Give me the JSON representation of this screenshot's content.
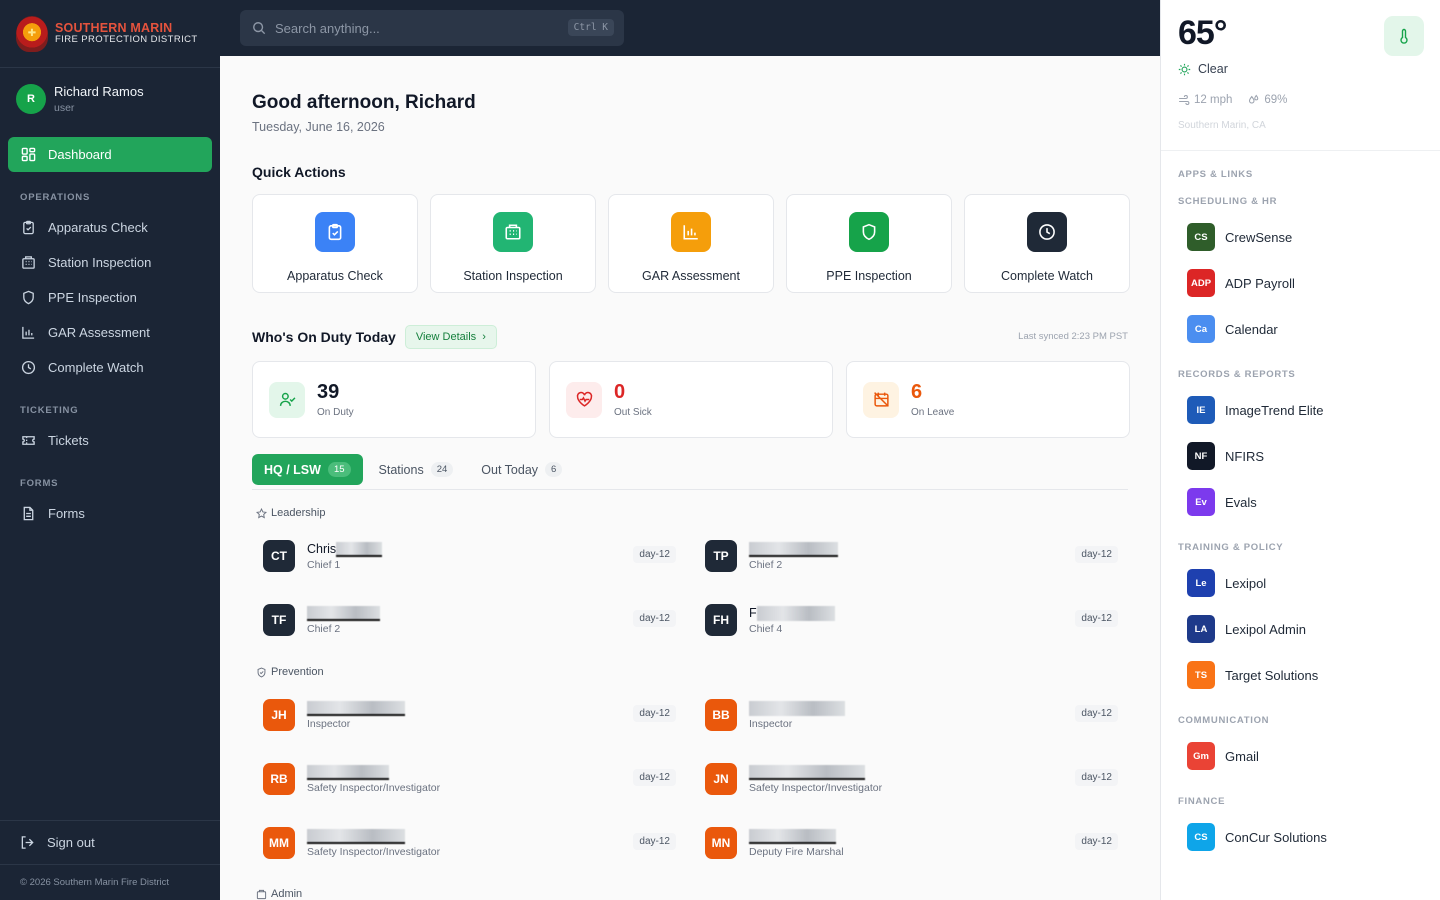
{
  "brand": {
    "line1": "SOUTHERN MARIN",
    "line2": "FIRE PROTECTION DISTRICT"
  },
  "user": {
    "initial": "R",
    "name": "Richard Ramos",
    "role": "user"
  },
  "sidebar": {
    "dashboard": "Dashboard",
    "sections": {
      "operations": "OPERATIONS",
      "ticketing": "TICKETING",
      "forms": "FORMS"
    },
    "items": {
      "apparatus_check": "Apparatus Check",
      "station_inspection": "Station Inspection",
      "ppe_inspection": "PPE Inspection",
      "gar_assessment": "GAR Assessment",
      "complete_watch": "Complete Watch",
      "tickets": "Tickets",
      "forms": "Forms"
    },
    "sign_out": "Sign out",
    "copyright": "© 2026 Southern Marin Fire District"
  },
  "search": {
    "placeholder": "Search anything...",
    "shortcut": "Ctrl K"
  },
  "main": {
    "greeting": "Good afternoon, Richard",
    "date": "Tuesday, June 16, 2026",
    "quick_actions_title": "Quick Actions",
    "quick_actions": [
      {
        "label": "Apparatus Check",
        "color": "#3b82f6"
      },
      {
        "label": "Station Inspection",
        "color": "#22b573"
      },
      {
        "label": "GAR Assessment",
        "color": "#f59e0b"
      },
      {
        "label": "PPE Inspection",
        "color": "#16a34a"
      },
      {
        "label": "Complete Watch",
        "color": "#1f2937"
      }
    ],
    "on_duty_title": "Who's On Duty Today",
    "view_details": "View Details",
    "last_synced": "Last synced 2:23 PM PST",
    "stats": [
      {
        "value": "39",
        "label": "On Duty",
        "color": "#111827"
      },
      {
        "value": "0",
        "label": "Out Sick",
        "color": "#dc2626"
      },
      {
        "value": "6",
        "label": "On Leave",
        "color": "#ea580c"
      }
    ],
    "tabs": [
      {
        "label": "HQ / LSW",
        "count": "15"
      },
      {
        "label": "Stations",
        "count": "24"
      },
      {
        "label": "Out Today",
        "count": "6"
      }
    ],
    "groups": {
      "leadership": "Leadership",
      "prevention": "Prevention",
      "admin": "Admin"
    },
    "people": [
      {
        "initials": "CT",
        "name": "Chris",
        "title": "Chief 1",
        "shift": "day-12"
      },
      {
        "initials": "TP",
        "name": "",
        "title": "Chief 2",
        "shift": "day-12"
      },
      {
        "initials": "TF",
        "name": "",
        "title": "Chief 2",
        "shift": "day-12"
      },
      {
        "initials": "FH",
        "name": "F",
        "title": "Chief 4",
        "shift": "day-12"
      },
      {
        "initials": "JH",
        "name": "",
        "title": "Inspector",
        "shift": "day-12"
      },
      {
        "initials": "BB",
        "name": "",
        "title": "Inspector",
        "shift": "day-12"
      },
      {
        "initials": "RB",
        "name": "",
        "title": "Safety Inspector/Investigator",
        "shift": "day-12"
      },
      {
        "initials": "JN",
        "name": "",
        "title": "Safety Inspector/Investigator",
        "shift": "day-12"
      },
      {
        "initials": "MM",
        "name": "",
        "title": "Safety Inspector/Investigator",
        "shift": "day-12"
      },
      {
        "initials": "MN",
        "name": "",
        "title": "Deputy Fire Marshal",
        "shift": "day-12"
      }
    ],
    "colors": {
      "leadership": "#1f2937",
      "prevention": "#ea580c"
    }
  },
  "weather": {
    "temp": "65°",
    "condition": "Clear",
    "wind": "12 mph",
    "humidity": "69%",
    "location": "Southern Marin, CA"
  },
  "apps": {
    "title": "APPS & LINKS",
    "categories": {
      "scheduling": "SCHEDULING & HR",
      "records": "RECORDS & REPORTS",
      "training": "TRAINING & POLICY",
      "communication": "COMMUNICATION",
      "finance": "FINANCE"
    },
    "links": [
      {
        "abbr": "CS",
        "label": "CrewSense",
        "color": "#2f5d2a"
      },
      {
        "abbr": "ADP",
        "label": "ADP Payroll",
        "color": "#dc2626"
      },
      {
        "abbr": "Ca",
        "label": "Calendar",
        "color": "#4b8ef0"
      },
      {
        "abbr": "IE",
        "label": "ImageTrend Elite",
        "color": "#1e5bb8"
      },
      {
        "abbr": "NF",
        "label": "NFIRS",
        "color": "#111827"
      },
      {
        "abbr": "Ev",
        "label": "Evals",
        "color": "#7c3aed"
      },
      {
        "abbr": "Le",
        "label": "Lexipol",
        "color": "#1e40af"
      },
      {
        "abbr": "LA",
        "label": "Lexipol Admin",
        "color": "#1e3a8a"
      },
      {
        "abbr": "TS",
        "label": "Target Solutions",
        "color": "#f97316"
      },
      {
        "abbr": "Gm",
        "label": "Gmail",
        "color": "#ea4335"
      },
      {
        "abbr": "CS",
        "label": "ConCur Solutions",
        "color": "#0ea5e9"
      }
    ]
  }
}
